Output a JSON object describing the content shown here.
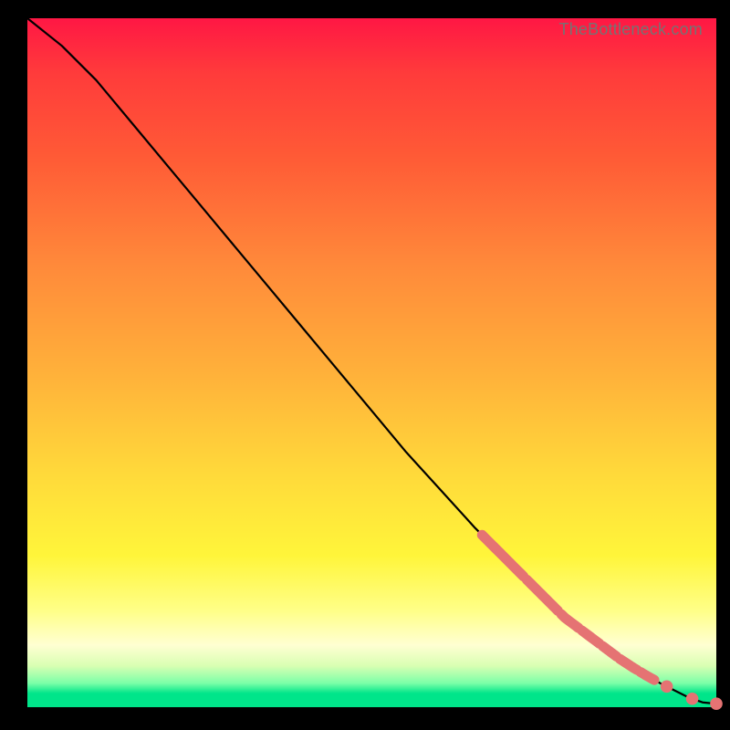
{
  "attribution": "TheBottleneck.com",
  "colors": {
    "marker": "#e57373",
    "line": "#000000",
    "gradient_top": "#ff1744",
    "gradient_bottom": "#00e58a"
  },
  "chart_data": {
    "type": "line",
    "title": "",
    "xlabel": "",
    "ylabel": "",
    "xlim": [
      0,
      100
    ],
    "ylim": [
      0,
      100
    ],
    "series": [
      {
        "name": "curve",
        "x": [
          0,
          5,
          10,
          15,
          20,
          25,
          30,
          35,
          40,
          45,
          50,
          55,
          60,
          65,
          68,
          70,
          72,
          74,
          76,
          78,
          80,
          82,
          84,
          86,
          88,
          90,
          92,
          94,
          96,
          98,
          100
        ],
        "y": [
          100,
          96,
          91,
          85,
          79,
          73,
          67,
          61,
          55,
          49,
          43,
          37,
          31.5,
          26,
          23,
          21,
          19,
          17,
          15,
          13,
          11.5,
          10,
          8.5,
          7,
          5.7,
          4.5,
          3.4,
          2.4,
          1.4,
          0.7,
          0.5
        ]
      }
    ],
    "highlighted_segments": [
      {
        "x_start": 66,
        "x_end": 72
      },
      {
        "x_start": 72.5,
        "x_end": 77
      },
      {
        "x_start": 77.5,
        "x_end": 80
      },
      {
        "x_start": 80.5,
        "x_end": 83
      },
      {
        "x_start": 83.5,
        "x_end": 85.5
      },
      {
        "x_start": 86,
        "x_end": 88.5
      },
      {
        "x_start": 89,
        "x_end": 91
      }
    ],
    "highlighted_points_x": [
      92.8,
      96.5,
      100
    ],
    "marker_radius_data_units": 0.9
  }
}
